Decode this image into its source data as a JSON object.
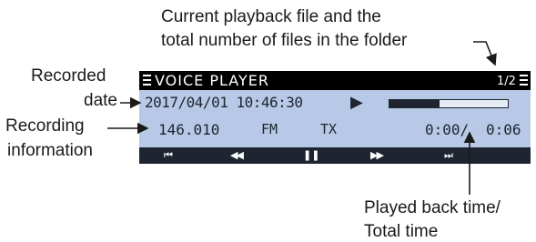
{
  "callouts": {
    "top_line1": "Current playback file and the",
    "top_line2": "total number of files in the folder",
    "recorded_line1": "Recorded",
    "recorded_line2": "date",
    "recording_line1": "Recording",
    "recording_line2": "information",
    "bottom_line1": "Played back time/",
    "bottom_line2": "Total time"
  },
  "screen": {
    "title": "VOICE PLAYER",
    "file_counter": "1/2",
    "recorded_date": "2017/04/01 10:46:30",
    "play_symbol": "▶",
    "playback_progress": 0.42,
    "frequency": "146.010",
    "mode": "FM",
    "tx": "TX",
    "played_time": "0:00/",
    "total_time": "0:06",
    "controls": [
      "⏮",
      "◀◀",
      "❚❚",
      "▶▶",
      "⏭"
    ]
  },
  "colors": {
    "lcd_background": "#b7c9e6",
    "lcd_dark": "#1e2530",
    "title_bar": "#000000"
  }
}
